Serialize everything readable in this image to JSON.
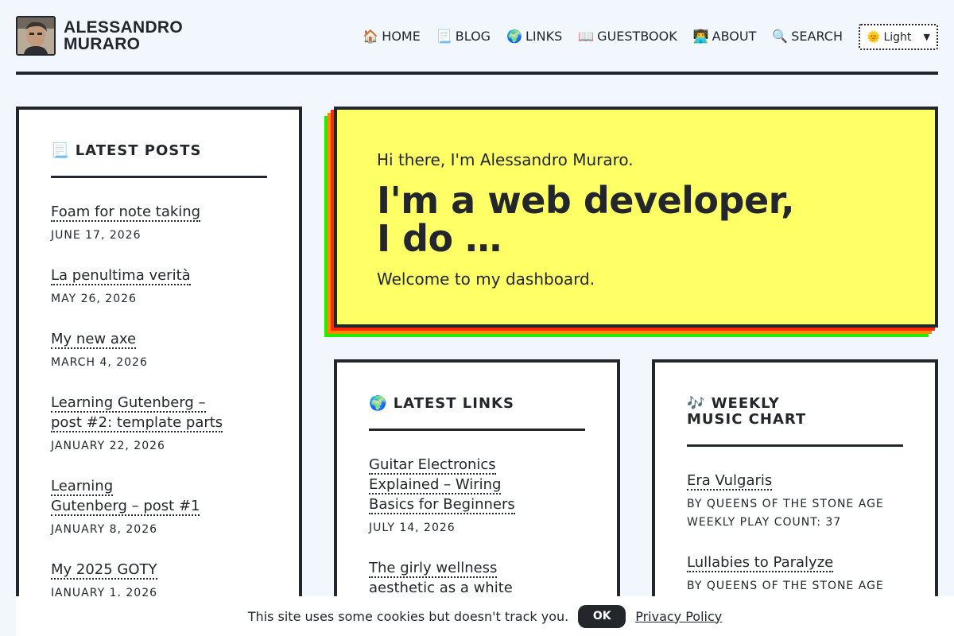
{
  "site": {
    "title_line1": "ALESSANDRO",
    "title_line2": "MURARO"
  },
  "nav": [
    {
      "icon": "🏠",
      "label": "HOME"
    },
    {
      "icon": "📃",
      "label": "BLOG"
    },
    {
      "icon": "🌍",
      "label": "LINKS"
    },
    {
      "icon": "📖",
      "label": "GUESTBOOK"
    },
    {
      "icon": "👨‍💻",
      "label": "ABOUT"
    },
    {
      "icon": "🔍",
      "label": "SEARCH"
    }
  ],
  "theme_select": {
    "icon": "🌞",
    "value": "Light"
  },
  "hero": {
    "intro": "Hi there, I'm Alessandro Muraro.",
    "headline_line1": "I'm a web developer,",
    "headline_line2": "I do …",
    "subtitle": "Welcome to my dashboard."
  },
  "latest_posts": {
    "icon": "📃",
    "title": "LATEST POSTS",
    "items": [
      {
        "title_lines": [
          "Foam for note taking"
        ],
        "date": "JUNE 17, 2026"
      },
      {
        "title_lines": [
          "La penultima verità"
        ],
        "date": "MAY 26, 2026"
      },
      {
        "title_lines": [
          "My new axe"
        ],
        "date": "MARCH 4, 2026"
      },
      {
        "title_lines": [
          "Learning Gutenberg –",
          "post #2: template parts"
        ],
        "date": "JANUARY 22, 2026"
      },
      {
        "title_lines": [
          "Learning",
          "Gutenberg – post #1"
        ],
        "date": "JANUARY 8, 2026"
      },
      {
        "title_lines": [
          "My 2025 GOTY"
        ],
        "date": "JANUARY 1, 2026"
      }
    ]
  },
  "latest_links": {
    "icon": "🌍",
    "title": "LATEST LINKS",
    "items": [
      {
        "title_lines": [
          "Guitar Electronics",
          "Explained – Wiring",
          "Basics for Beginners"
        ],
        "date": "JULY 14, 2026"
      },
      {
        "title_lines": [
          "The girly wellness",
          "aesthetic as a white"
        ],
        "date": ""
      }
    ]
  },
  "music_chart": {
    "icon": "🎶",
    "title_line1": "WEEKLY",
    "title_line2": "MUSIC CHART",
    "items": [
      {
        "title": "Era Vulgaris",
        "artist": "BY QUEENS OF THE STONE AGE",
        "plays": "WEEKLY PLAY COUNT: 37"
      },
      {
        "title": "Lullabies to Paralyze",
        "artist": "BY QUEENS OF THE STONE AGE",
        "plays": ""
      }
    ]
  },
  "cookie": {
    "message": "This site uses some cookies but doesn't track you.",
    "ok": "OK",
    "policy": "Privacy Policy"
  },
  "colors": {
    "ink": "#23272b",
    "page_bg": "#f2f7fd",
    "hero_bg": "#ffff66",
    "hero_shadow_red": "#ff2a00",
    "hero_shadow_orange": "#ff8800",
    "hero_shadow_green": "#22ee00"
  }
}
